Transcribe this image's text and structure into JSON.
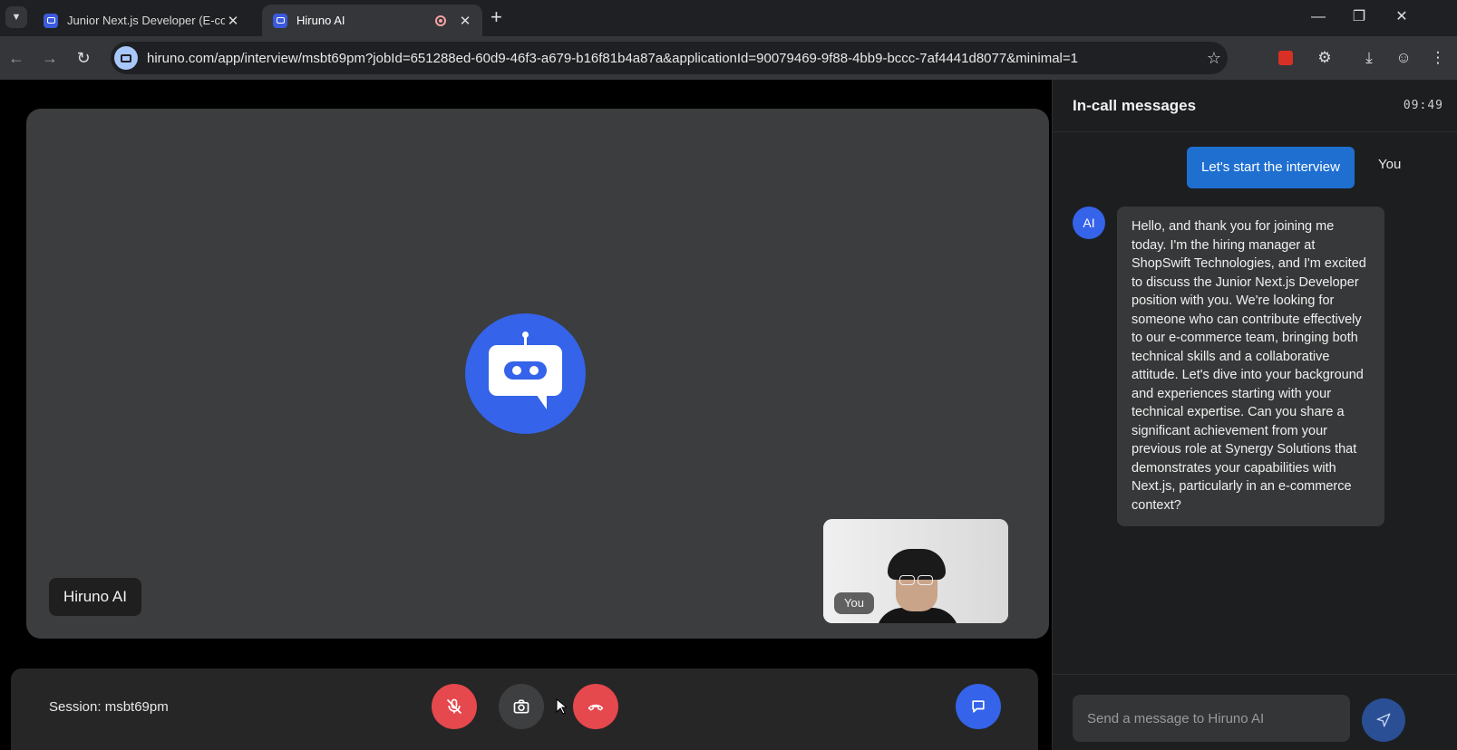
{
  "browser": {
    "tabs": [
      {
        "title": "Junior Next.js Developer (E-com",
        "active": false
      },
      {
        "title": "Hiruno AI",
        "active": true
      }
    ],
    "url": "hiruno.com/app/interview/msbt69pm?jobId=651288ed-60d9-46f3-a679-b16f81b4a87a&applicationId=90079469-9f88-4bb9-bccc-7af4441d8077&minimal=1"
  },
  "call": {
    "participant_label": "Hiruno AI",
    "self_label": "You",
    "session_text": "Session: msbt69pm"
  },
  "chat": {
    "title": "In-call messages",
    "timer": "09:49",
    "messages": [
      {
        "sender": "You",
        "text": "Let's start the interview"
      },
      {
        "sender": "AI",
        "text": "Hello, and thank you for joining me today. I'm the hiring manager at ShopSwift Technologies, and I'm excited to discuss the Junior Next.js Developer position with you. We're looking for someone who can contribute effectively to our e-commerce team, bringing both technical skills and a collaborative attitude. Let's dive into your background and experiences starting with your technical expertise. Can you share a significant achievement from your previous role at Synergy Solutions that demonstrates your capabilities with Next.js, particularly in an e-commerce context?"
      }
    ],
    "input_placeholder": "Send a message to Hiruno AI"
  },
  "colors": {
    "accent": "#3563e9",
    "user_bubble": "#1f6fd1",
    "danger": "#e5484d"
  }
}
